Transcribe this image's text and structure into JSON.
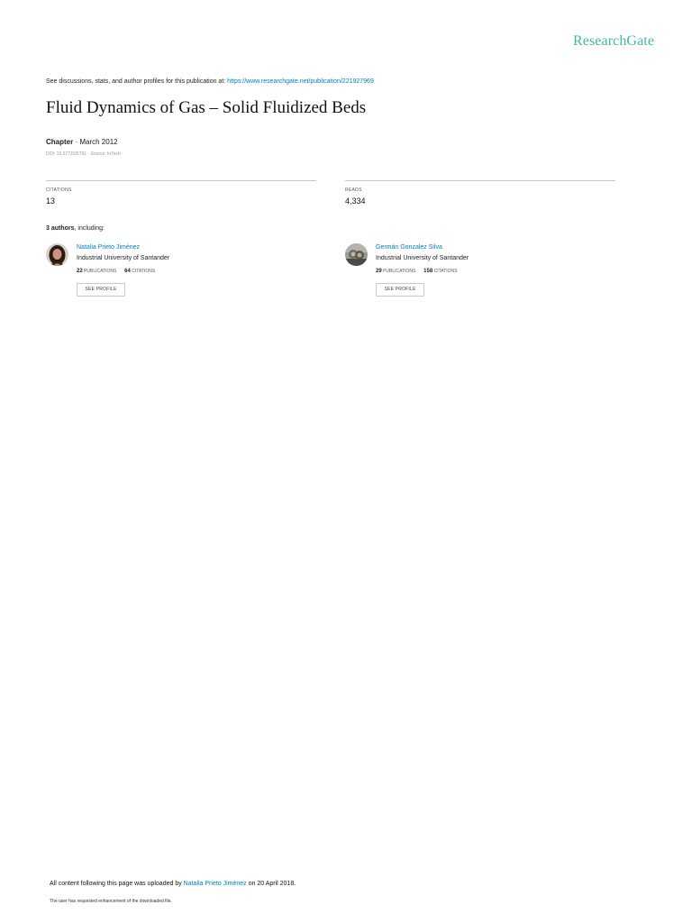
{
  "brand": {
    "name": "ResearchGate",
    "color": "#40BA9B"
  },
  "discussion": {
    "prefix": "See discussions, stats, and author profiles for this publication at: ",
    "url": "https://www.researchgate.net/publication/221927969"
  },
  "publication": {
    "title": "Fluid Dynamics of Gas – Solid Fluidized Beds",
    "type": "Chapter",
    "separator": " · ",
    "date": "March 2012",
    "doi_line": "DOI: 10.5772/25791 · Source: InTech"
  },
  "stats": {
    "citations_label": "CITATIONS",
    "citations_value": "13",
    "reads_label": "READS",
    "reads_value": "4,334"
  },
  "authors_header": {
    "count": "3 authors",
    "suffix": ", including:"
  },
  "authors": [
    {
      "name": "Natalia Prieto Jiménez",
      "institution": "Industrial University of Santander",
      "publications": "22",
      "publications_label": "PUBLICATIONS",
      "citations": "64",
      "citations_label": "CITATIONS",
      "button": "SEE PROFILE"
    },
    {
      "name": "Germán Gonzalez Silva",
      "institution": "Industrial University of Santander",
      "publications": "29",
      "publications_label": "PUBLICATIONS",
      "citations": "158",
      "citations_label": "CITATIONS",
      "button": "SEE PROFILE"
    }
  ],
  "footer": {
    "upload_prefix": "All content following this page was uploaded by ",
    "uploader": "Natalia Prieto Jiménez",
    "upload_suffix": " on 20 April 2018.",
    "request_note": "The user has requested enhancement of the downloaded file."
  },
  "colors": {
    "link": "#0080C0",
    "divider": "#C8C8C8"
  }
}
